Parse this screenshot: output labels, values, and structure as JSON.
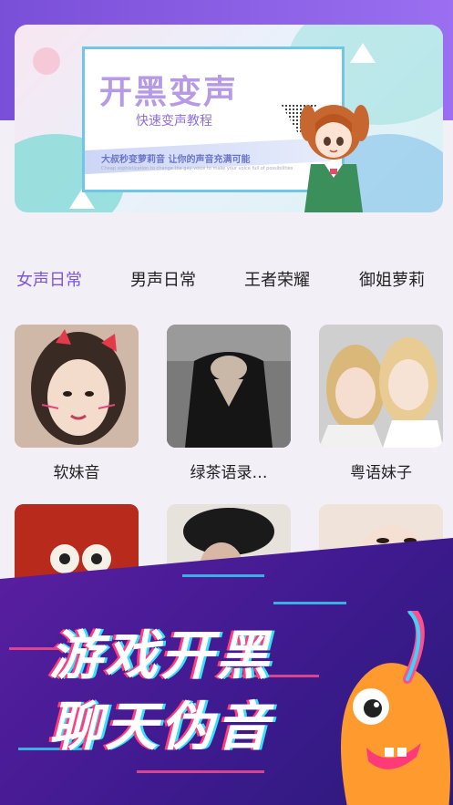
{
  "banner": {
    "title": "开黑变声",
    "subtitle": "快速变声教程",
    "slogan": "大叔秒变萝莉音 让你的声音充满可能",
    "slogan_en": "Cheap sophistication to change the gay voice to make your voice full of possibilities"
  },
  "tabs": [
    {
      "label": "女声日常",
      "active": true
    },
    {
      "label": "男声日常",
      "active": false
    },
    {
      "label": "王者荣耀",
      "active": false
    },
    {
      "label": "御姐萝莉",
      "active": false
    }
  ],
  "cards": [
    {
      "label": "软妹音"
    },
    {
      "label": "绿茶语录…"
    },
    {
      "label": "粤语妹子"
    }
  ],
  "promo": {
    "line1": "游戏开黑",
    "line2": "聊天伪音"
  },
  "colors": {
    "accent": "#7c56d8",
    "header": "#8a5fe6",
    "promo_bg": "#3f1a8f"
  }
}
